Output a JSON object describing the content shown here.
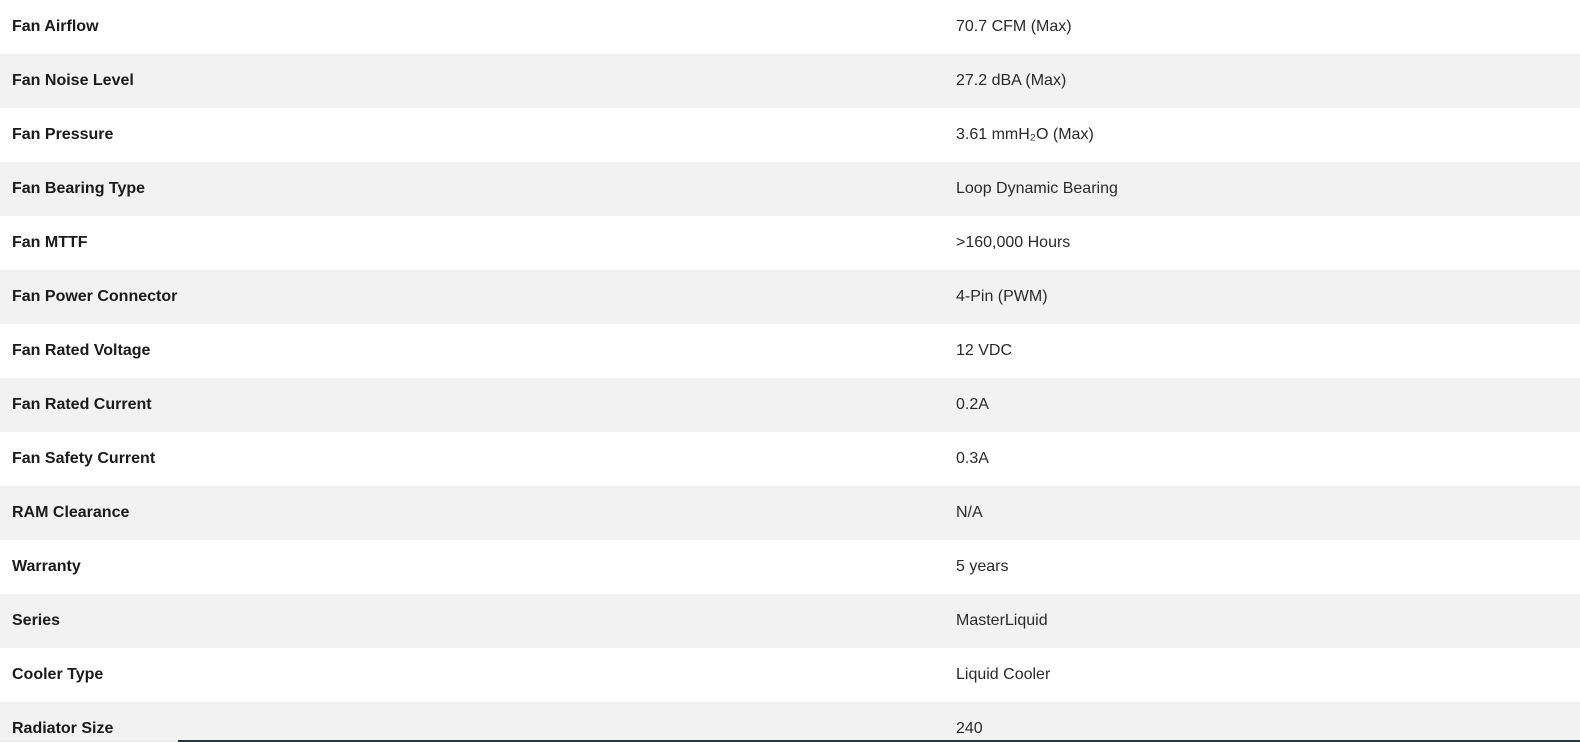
{
  "specs": [
    {
      "label": "Fan Airflow",
      "value": "70.7 CFM (Max)"
    },
    {
      "label": "Fan Noise Level",
      "value": "27.2 dBA (Max)"
    },
    {
      "label": "Fan Pressure",
      "value": "3.61 mmH₂O (Max)"
    },
    {
      "label": "Fan Bearing Type",
      "value": "Loop Dynamic Bearing"
    },
    {
      "label": "Fan MTTF",
      "value": ">160,000 Hours"
    },
    {
      "label": "Fan Power Connector",
      "value": "4-Pin (PWM)"
    },
    {
      "label": "Fan Rated Voltage",
      "value": "12 VDC"
    },
    {
      "label": "Fan Rated Current",
      "value": "0.2A"
    },
    {
      "label": "Fan Safety Current",
      "value": "0.3A"
    },
    {
      "label": "RAM Clearance",
      "value": "N/A"
    },
    {
      "label": "Warranty",
      "value": "5 years"
    },
    {
      "label": "Series",
      "value": "MasterLiquid"
    },
    {
      "label": "Cooler Type",
      "value": "Liquid Cooler"
    },
    {
      "label": "Radiator Size",
      "value": "240"
    }
  ]
}
